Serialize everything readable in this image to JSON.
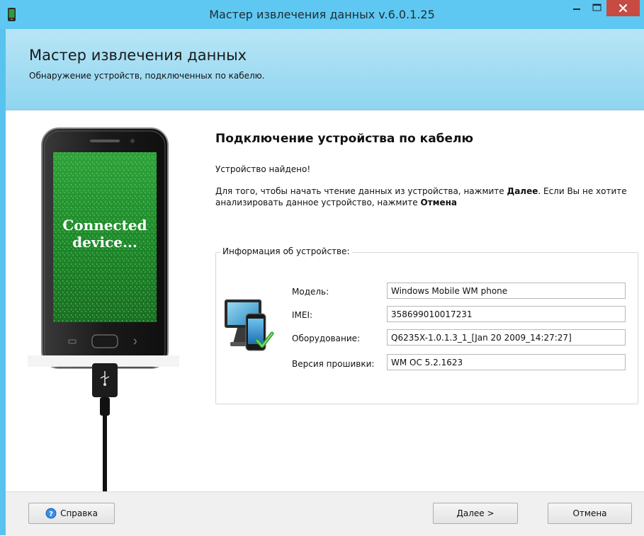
{
  "window": {
    "title": "Мастер извлечения данных v.6.0.1.25",
    "accent_color": "#5ec8f2",
    "close_color": "#c74a43"
  },
  "header": {
    "title": "Мастер извлечения данных",
    "subtitle": "Обнаружение устройств, подключенных по кабелю."
  },
  "illustration": {
    "screen_text_line1": "Connected",
    "screen_text_line2": "device..."
  },
  "main": {
    "section_title": "Подключение устройства по кабелю",
    "found_text": "Устройство найдено!",
    "instruction_part1": "Для того, чтобы начать чтение данных из устройства, нажмите ",
    "instruction_next": "Далее",
    "instruction_part2": ". Если Вы не хотите анализировать данное устройство, нажмите ",
    "instruction_cancel": "Отмена"
  },
  "device_info": {
    "legend": "Информация об устройстве:",
    "fields": [
      {
        "label": "Модель:",
        "value": "Windows Mobile WM phone"
      },
      {
        "label": "IMEI:",
        "value": "358699010017231"
      },
      {
        "label": "Оборудование:",
        "value": "Q6235X-1.0.1.3_1_[Jan 20 2009_14:27:27]"
      },
      {
        "label": "Версия прошивки:",
        "value": "WM OC 5.2.1623"
      }
    ]
  },
  "footer": {
    "help_label": "Справка",
    "next_label": "Далее >",
    "cancel_label": "Отмена"
  }
}
